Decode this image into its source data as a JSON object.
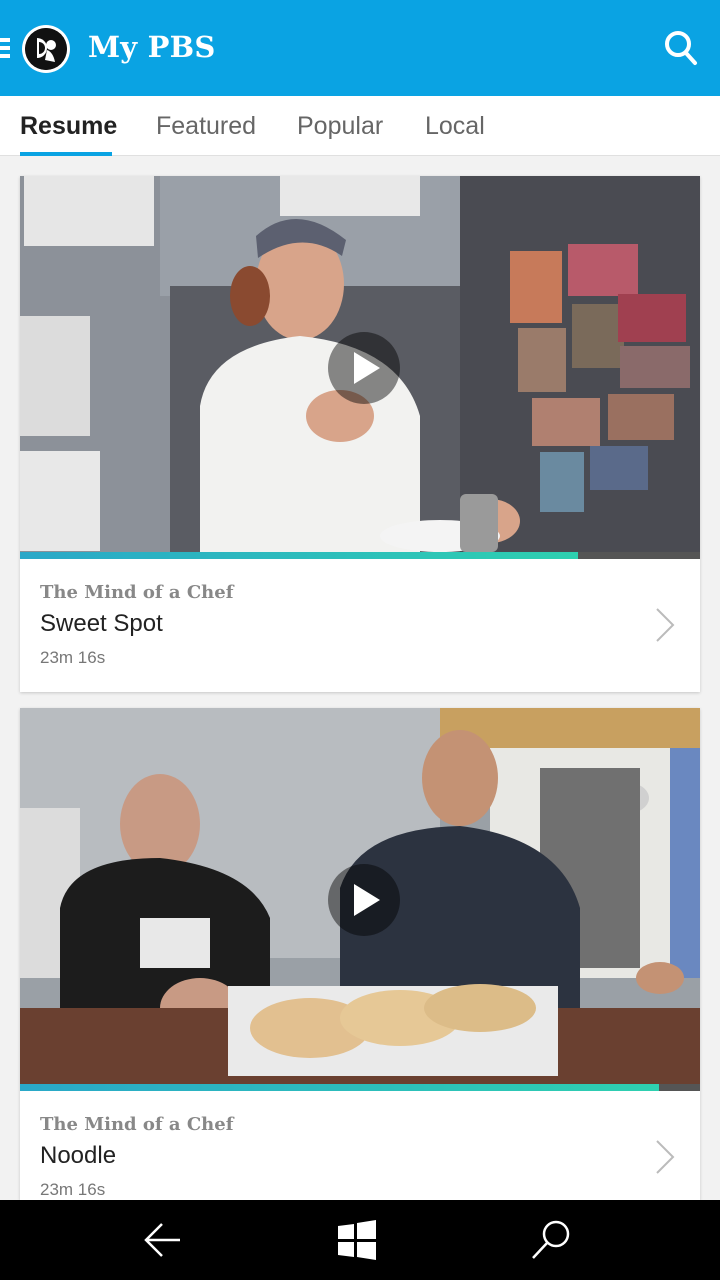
{
  "app": {
    "title": "My PBS",
    "colors": {
      "brand": "#0aa3e3",
      "progress": "#2ed0b0"
    },
    "icons": {
      "menu": "hamburger-icon",
      "logo": "pbs-logo",
      "search": "search-icon"
    }
  },
  "tabs": [
    {
      "label": "Resume",
      "active": true
    },
    {
      "label": "Featured",
      "active": false
    },
    {
      "label": "Popular",
      "active": false
    },
    {
      "label": "Local",
      "active": false
    }
  ],
  "cards": [
    {
      "show": "The Mind of a Chef",
      "episode": "Sweet Spot",
      "duration": "23m 16s",
      "progress": 0.82
    },
    {
      "show": "The Mind of a Chef",
      "episode": "Noodle",
      "duration": "23m 16s",
      "progress": 0.94
    }
  ],
  "system_nav": {
    "back": "back-arrow-icon",
    "home": "windows-icon",
    "search": "search-icon"
  }
}
